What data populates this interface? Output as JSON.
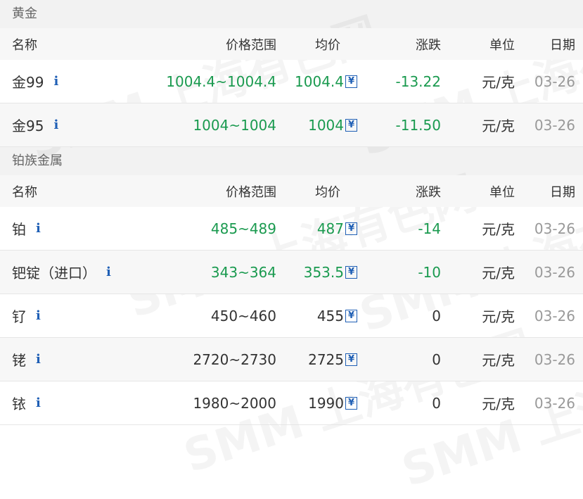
{
  "sections": [
    {
      "title": "黄金",
      "headers": {
        "name": "名称",
        "range": "价格范围",
        "avg": "均价",
        "change": "涨跌",
        "unit": "单位",
        "date": "日期"
      },
      "rows": [
        {
          "name": "金99",
          "range": "1004.4~1004.4",
          "avg": "1004.4",
          "change": "-13.22",
          "unit": "元/克",
          "date": "03-26",
          "color": "green"
        },
        {
          "name": "金95",
          "range": "1004~1004",
          "avg": "1004",
          "change": "-11.50",
          "unit": "元/克",
          "date": "03-26",
          "color": "green"
        }
      ]
    },
    {
      "title": "铂族金属",
      "headers": {
        "name": "名称",
        "range": "价格范围",
        "avg": "均价",
        "change": "涨跌",
        "unit": "单位",
        "date": "日期"
      },
      "rows": [
        {
          "name": "铂",
          "range": "485~489",
          "avg": "487",
          "change": "-14",
          "unit": "元/克",
          "date": "03-26",
          "color": "green"
        },
        {
          "name": "钯锭（进口）",
          "range": "343~364",
          "avg": "353.5",
          "change": "-10",
          "unit": "元/克",
          "date": "03-26",
          "color": "green"
        },
        {
          "name": "钌",
          "range": "450~460",
          "avg": "455",
          "change": "0",
          "unit": "元/克",
          "date": "03-26",
          "color": "black"
        },
        {
          "name": "铑",
          "range": "2720~2730",
          "avg": "2725",
          "change": "0",
          "unit": "元/克",
          "date": "03-26",
          "color": "black"
        },
        {
          "name": "铱",
          "range": "1980~2000",
          "avg": "1990",
          "change": "0",
          "unit": "元/克",
          "date": "03-26",
          "color": "black"
        }
      ]
    }
  ],
  "icons": {
    "info": "i",
    "currency": "¥"
  },
  "watermark": "SMM 上海有色网",
  "colors": {
    "up_down_green": "#1a9a4f",
    "icon_blue": "#1f5fb5",
    "section_bg": "#f2f2f2",
    "header_bg": "#f7f7f7"
  }
}
